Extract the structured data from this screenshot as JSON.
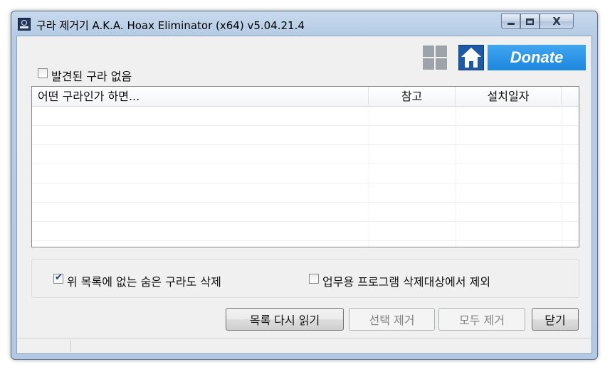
{
  "window": {
    "title": "구라 제거기 A.K.A. Hoax Eliminator (x64) v5.04.21.4",
    "close_glyph": "X"
  },
  "top": {
    "no_hoax_label": "발견된 구라 없음",
    "no_hoax_checked": false,
    "donate_label": "Donate"
  },
  "list": {
    "columns": [
      "어떤 구라인가 하면...",
      "참고",
      "설치일자"
    ],
    "rows": []
  },
  "options": {
    "hidden_remove_label": "위 목록에 없는 숨은 구라도 삭제",
    "hidden_remove_checked": true,
    "exclude_business_label": "업무용 프로그램 삭제대상에서 제외",
    "exclude_business_checked": false
  },
  "buttons": {
    "reload": "목록 다시 읽기",
    "remove_selected": "선택 제거",
    "remove_all": "모두 제거",
    "close": "닫기"
  },
  "colors": {
    "donate_bg": "#1d86de",
    "home_bg": "#1c5aa6",
    "frame": "#b7cde6"
  }
}
